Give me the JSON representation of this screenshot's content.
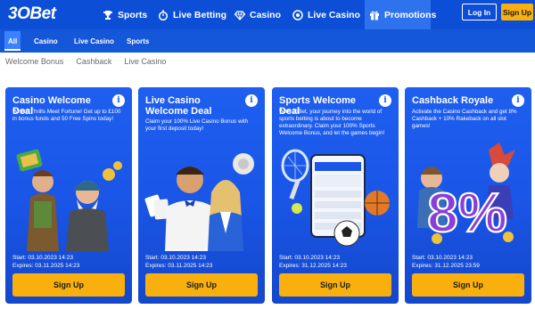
{
  "brand": {
    "logo_text": "3OBet"
  },
  "nav": {
    "sports": "Sports",
    "live_betting": "Live Betting",
    "casino": "Casino",
    "live_casino": "Live Casino",
    "promotions": "Promotions",
    "login": "Log In",
    "signup": "Sign Up"
  },
  "subnav": [
    "All",
    "Casino",
    "Live Casino",
    "Sports"
  ],
  "crumbs": [
    "Welcome Bonus",
    "Cashback",
    "Live Casino"
  ],
  "info_glyph": "i",
  "cards": [
    {
      "title": "Casino Welcome Deal",
      "desc": "Where Thrills Meet Fortune! Get up to £100 in bonus funds and 50 Free Spins today!",
      "start": "Start: 03.10.2023 14:23",
      "expires": "Expires: 03.11.2025 14:23",
      "button": "Sign Up"
    },
    {
      "title": "Live Casino Welcome Deal",
      "desc": "Claim your 100% Live Casino Bonus with your first deposit today!",
      "start": "Start: 03.10.2023 14:23",
      "expires": "Expires: 03.11.2025 14:23",
      "button": "Sign Up"
    },
    {
      "title": "Sports Welcome Deal",
      "desc": "With 30Bet, your journey into the world of sports betting is about to become extraordinary. Claim your 100% Sports Welcome Bonus, and let the games begin!",
      "start": "Start: 03.10.2023 14:23",
      "expires": "Expires: 31.12.2025 14:23",
      "button": "Sign Up"
    },
    {
      "title": "Cashback Royale",
      "desc": "Activate the Casino Cashback and get 8% Cashback + 10% Rakeback on all slot games!",
      "start": "Start: 03.10.2023 14:23",
      "expires": "Expires: 31.12.2025 23:59",
      "button": "Sign Up",
      "art_text": "8%"
    }
  ],
  "colors": {
    "nav_bg": "#0c4fd6",
    "subnav_bg": "#1557d9",
    "card_bg": "#1a56e8",
    "accent": "#f9b00f"
  }
}
